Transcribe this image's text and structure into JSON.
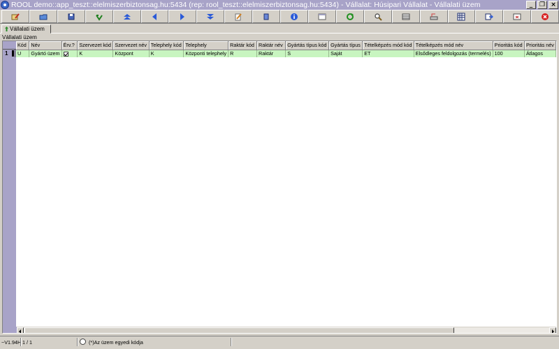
{
  "window": {
    "title": "ROOL demo::app_teszt::elelmiszerbiztonsag.hu:5434 (rep: rool_teszt::elelmiszerbiztonsag.hu:5434) - Vállalat: Húsipari Vállalat - Vállalati üzem",
    "minimize_glyph": "_",
    "restore_glyph": "❐",
    "close_glyph": "×"
  },
  "toolbar": {
    "buttons": [
      "edit-wizard-icon",
      "open-folder-icon",
      "save-icon",
      "undo-green-icon",
      "first-record-icon",
      "previous-record-icon",
      "next-record-icon",
      "last-record-icon",
      "edit-pencil-icon",
      "copy-icon",
      "info-icon",
      "window-icon",
      "refresh-icon",
      "search-icon",
      "columns-icon",
      "print-icon",
      "grid-icon",
      "export-icon",
      "exit-window-icon",
      "exit-icon"
    ]
  },
  "tab": {
    "label": "Vállalati üzem"
  },
  "panel": {
    "label": "Vállalati üzem"
  },
  "grid": {
    "columns": [
      "Kód",
      "Név",
      "Érv.?",
      "Szervezet kód",
      "Szervezet név",
      "Telephely kód",
      "Telephely",
      "Raktár kód",
      "Raktár név",
      "Gyártás típus kód",
      "Gyártás típus",
      "Tételképzés mód kód",
      "Tételképzés mód név",
      "Prioritás kód",
      "Prioritás név"
    ],
    "rows": [
      {
        "num": "1",
        "cells": [
          "U",
          "Gyártó üzem",
          "",
          "K",
          "Központ",
          "K",
          "Központi telephely",
          "R",
          "Raktár",
          "S",
          "Saját",
          "ET",
          "Elsődleges feldolgozás (termelés)",
          "100",
          "Átlagos"
        ],
        "valid_checked": true
      }
    ]
  },
  "status": {
    "version": "~V1.94H",
    "position": "1 / 1",
    "note": "(*)Az üzem egyedi kódja"
  },
  "colors": {
    "title_bar": "#a8a3c8",
    "row_highlight": "#c8f5c0",
    "chrome": "#d4d0c8"
  }
}
